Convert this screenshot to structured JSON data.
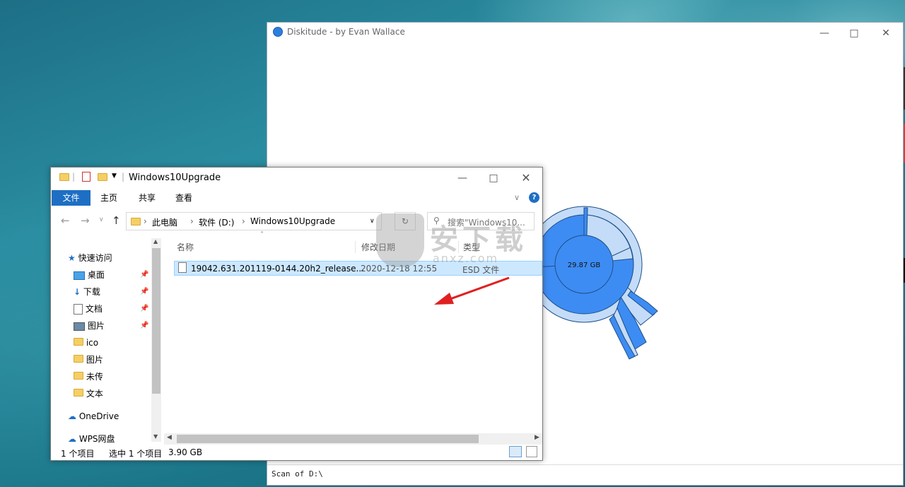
{
  "diskitude": {
    "title": "Diskitude - by Evan Wallace",
    "center_label": "29.87 GB",
    "status": "Scan of D:\\"
  },
  "explorer": {
    "title": "Windows10Upgrade",
    "ribbon_tabs": [
      "文件",
      "主页",
      "共享",
      "查看"
    ],
    "breadcrumb": [
      "此电脑",
      "软件 (D:)",
      "Windows10Upgrade"
    ],
    "search_placeholder": "搜索\"Windows10...",
    "nav": {
      "quick_access": "快速访问",
      "items": [
        "桌面",
        "下载",
        "文档",
        "图片",
        "ico",
        "图片",
        "未传",
        "文本"
      ],
      "onedrive": "OneDrive",
      "wps": "WPS网盘"
    },
    "columns": {
      "name": "名称",
      "modified": "修改日期",
      "type": "类型"
    },
    "files": [
      {
        "name": "19042.631.201119-0144.20h2_release...",
        "modified": "2020-12-18 12:55",
        "type": "ESD 文件"
      }
    ],
    "status": {
      "count": "1 个项目",
      "selected": "选中 1 个项目",
      "size": "3.90 GB"
    }
  },
  "watermark": {
    "text": "安下载",
    "sub": "anxz.com"
  },
  "colors": {
    "accent": "#1e6fc4",
    "sunburst_dark": "#3d8cf3",
    "sunburst_light": "#c4dcf7",
    "arrow": "#e02020"
  }
}
